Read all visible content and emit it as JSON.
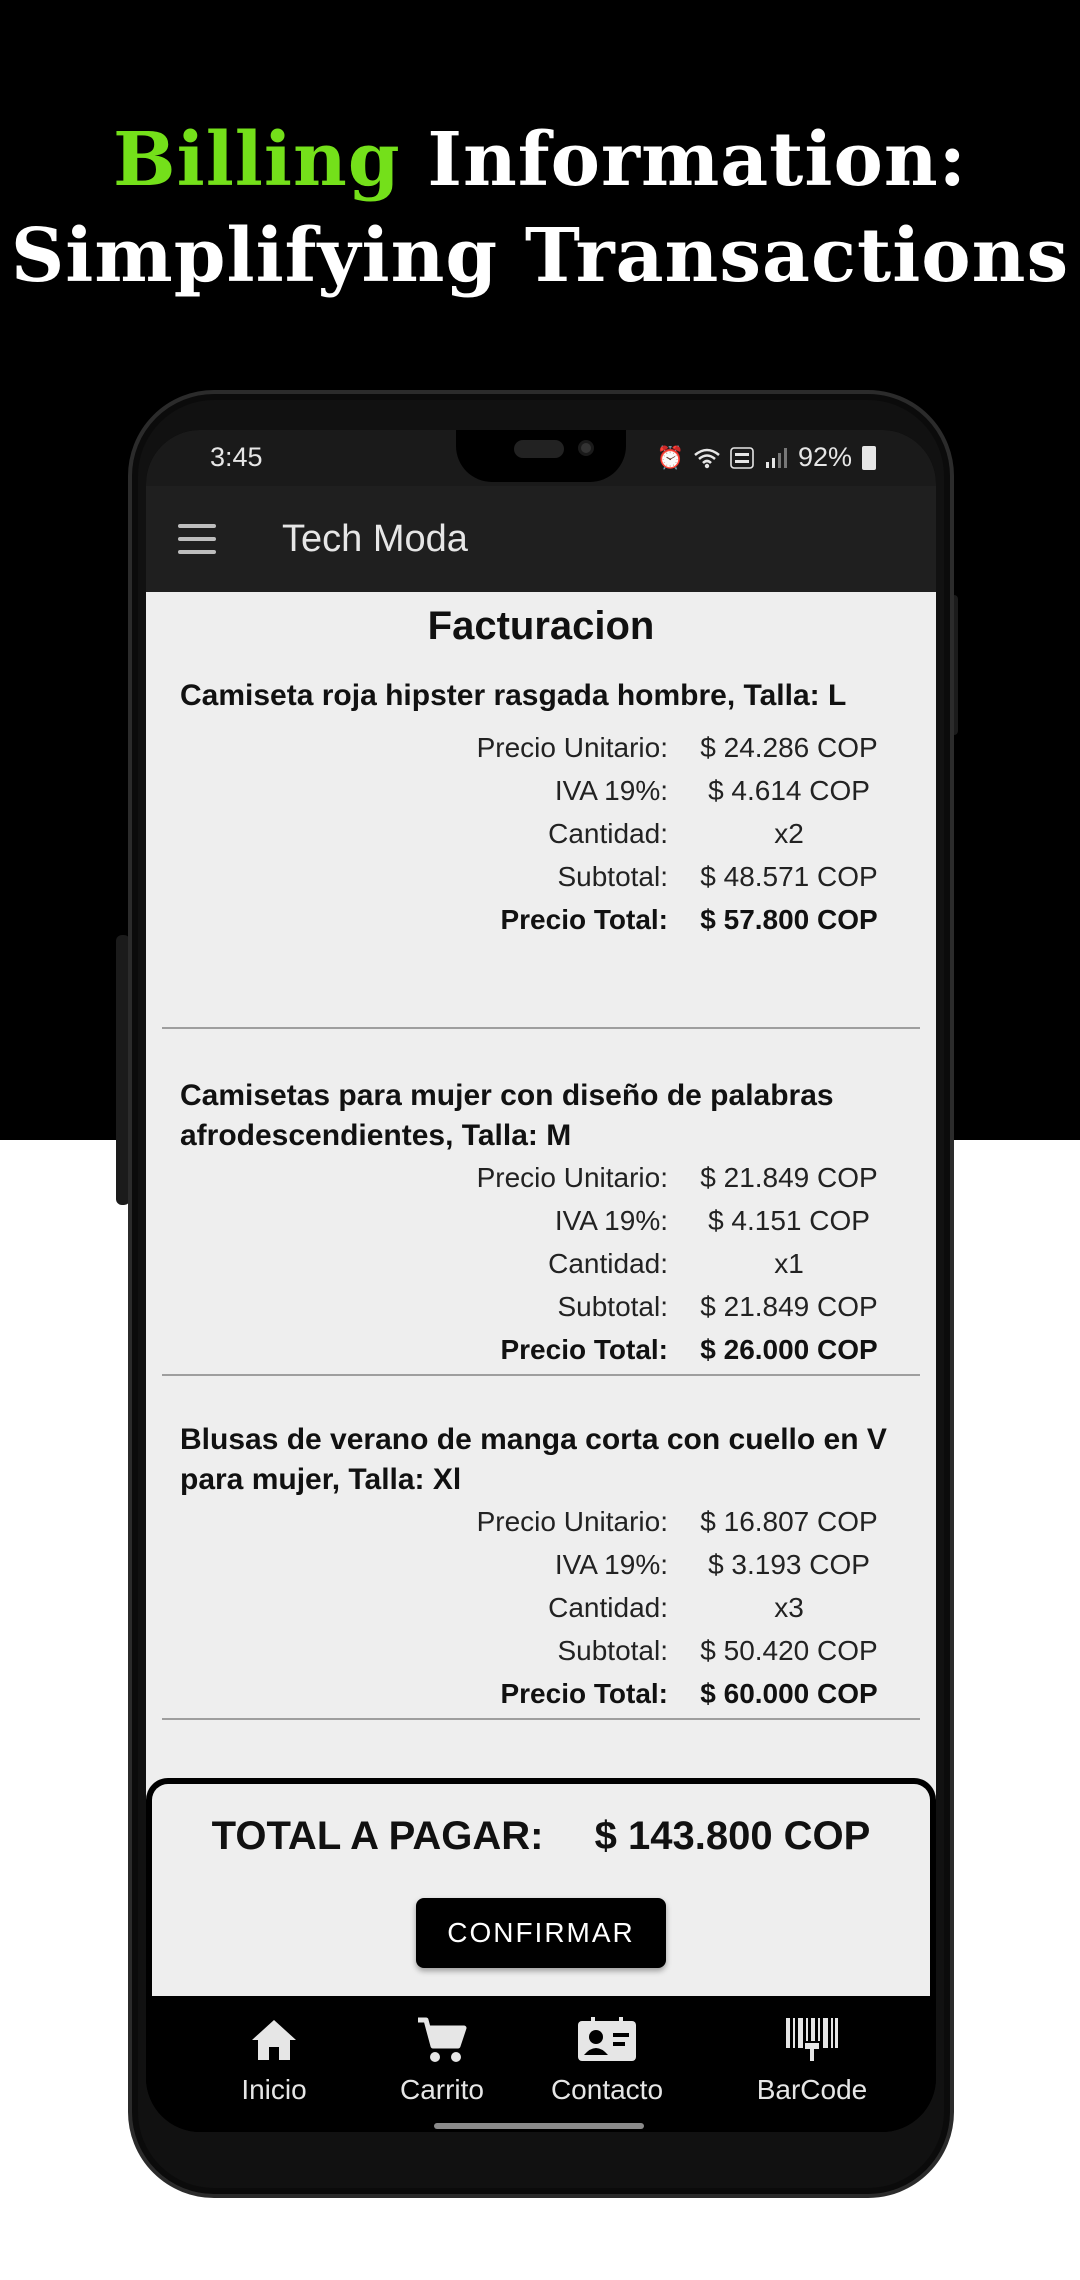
{
  "headline": {
    "accent": "Billing",
    "line1_rest": "Information:",
    "line2": "Simplifying Transactions"
  },
  "colors": {
    "accent": "#74e01a",
    "appbar": "#1f1f1f",
    "content_bg": "#eeeeee"
  },
  "status_bar": {
    "time": "3:45",
    "battery": "92%",
    "icons": [
      "alarm-icon",
      "wifi-icon",
      "volte-icon",
      "signal-icon",
      "battery-icon"
    ]
  },
  "appbar": {
    "title": "Tech Moda",
    "menu_icon": "hamburger-menu-icon"
  },
  "page": {
    "title": "Facturacion"
  },
  "labels": {
    "unit_price": "Precio Unitario:",
    "iva": "IVA 19%:",
    "quantity": "Cantidad:",
    "subtotal": "Subtotal:",
    "total": "Precio Total:"
  },
  "items": [
    {
      "name": "Camiseta roja hipster rasgada hombre, Talla: L",
      "unit_price": "$ 24.286 COP",
      "iva": "$ 4.614 COP",
      "quantity": "x2",
      "subtotal": "$ 48.571 COP",
      "total": "$ 57.800 COP"
    },
    {
      "name": "Camisetas para mujer con diseño de palabras afrodescendientes, Talla: M",
      "unit_price": "$ 21.849 COP",
      "iva": "$ 4.151 COP",
      "quantity": "x1",
      "subtotal": "$ 21.849 COP",
      "total": "$ 26.000 COP"
    },
    {
      "name": "Blusas de verano de manga corta con cuello en V para mujer, Talla: Xl",
      "unit_price": "$ 16.807 COP",
      "iva": "$ 3.193 COP",
      "quantity": "x3",
      "subtotal": "$ 50.420 COP",
      "total": "$ 60.000 COP"
    }
  ],
  "summary": {
    "label": "TOTAL A PAGAR:",
    "amount": "$ 143.800 COP",
    "confirm_label": "CONFIRMAR"
  },
  "bottom_nav": [
    {
      "label": "Inicio",
      "icon": "home-icon"
    },
    {
      "label": "Carrito",
      "icon": "cart-icon"
    },
    {
      "label": "Contacto",
      "icon": "contact-card-icon"
    },
    {
      "label": "BarCode",
      "icon": "barcode-icon"
    }
  ]
}
